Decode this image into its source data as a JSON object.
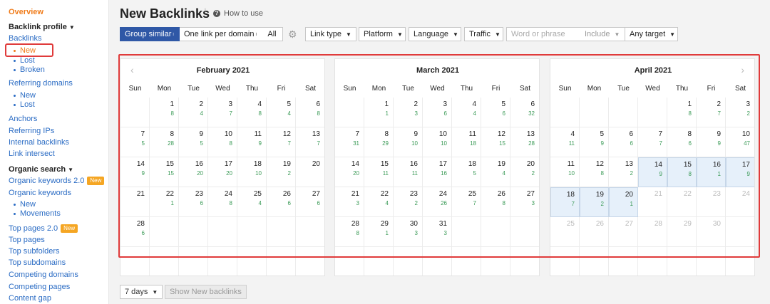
{
  "sidebar": {
    "overview": "Overview",
    "backlink_profile": "Backlink profile",
    "backlinks": "Backlinks",
    "backlinks_new": "New",
    "backlinks_lost": "Lost",
    "backlinks_broken": "Broken",
    "referring_domains": "Referring domains",
    "rd_new": "New",
    "rd_lost": "Lost",
    "anchors": "Anchors",
    "referring_ips": "Referring IPs",
    "internal_backlinks": "Internal backlinks",
    "link_intersect": "Link intersect",
    "organic_search": "Organic search",
    "organic_keywords_2": "Organic keywords 2.0",
    "new_badge": "New",
    "organic_keywords": "Organic keywords",
    "ok_new": "New",
    "ok_movements": "Movements",
    "top_pages_2": "Top pages 2.0",
    "top_pages": "Top pages",
    "top_subfolders": "Top subfolders",
    "top_subdomains": "Top subdomains",
    "competing_domains": "Competing domains",
    "competing_pages": "Competing pages",
    "content_gap": "Content gap"
  },
  "header": {
    "title": "New Backlinks",
    "title_info": "i",
    "how_to": "How to use"
  },
  "toolbar": {
    "group_similar": "Group similar",
    "one_link": "One link per domain",
    "all": "All",
    "link_type": "Link type",
    "platform": "Platform",
    "language": "Language",
    "traffic": "Traffic",
    "search_placeholder": "Word or phrase",
    "include": "Include",
    "any_target": "Any target"
  },
  "weekdays": [
    "Sun",
    "Mon",
    "Tue",
    "Wed",
    "Thu",
    "Fri",
    "Sat"
  ],
  "months": [
    {
      "name": "February 2021",
      "weeks": [
        [
          {
            "d": ""
          },
          {
            "d": "1",
            "c": "8"
          },
          {
            "d": "2",
            "c": "4"
          },
          {
            "d": "3",
            "c": "7"
          },
          {
            "d": "4",
            "c": "8"
          },
          {
            "d": "5",
            "c": "4"
          },
          {
            "d": "6",
            "c": "8"
          }
        ],
        [
          {
            "d": "7",
            "c": "5"
          },
          {
            "d": "8",
            "c": "28"
          },
          {
            "d": "9",
            "c": "5"
          },
          {
            "d": "10",
            "c": "8"
          },
          {
            "d": "11",
            "c": "9"
          },
          {
            "d": "12",
            "c": "7"
          },
          {
            "d": "13",
            "c": "7"
          }
        ],
        [
          {
            "d": "14",
            "c": "9"
          },
          {
            "d": "15",
            "c": "15"
          },
          {
            "d": "16",
            "c": "20"
          },
          {
            "d": "17",
            "c": "20"
          },
          {
            "d": "18",
            "c": "10"
          },
          {
            "d": "19",
            "c": "2"
          },
          {
            "d": "20"
          }
        ],
        [
          {
            "d": "21"
          },
          {
            "d": "22",
            "c": "1"
          },
          {
            "d": "23",
            "c": "6"
          },
          {
            "d": "24",
            "c": "8"
          },
          {
            "d": "25",
            "c": "4"
          },
          {
            "d": "26",
            "c": "6"
          },
          {
            "d": "27",
            "c": "6"
          }
        ],
        [
          {
            "d": "28",
            "c": "6"
          },
          {
            "d": ""
          },
          {
            "d": ""
          },
          {
            "d": ""
          },
          {
            "d": ""
          },
          {
            "d": ""
          },
          {
            "d": ""
          }
        ],
        [
          {
            "d": ""
          },
          {
            "d": ""
          },
          {
            "d": ""
          },
          {
            "d": ""
          },
          {
            "d": ""
          },
          {
            "d": ""
          },
          {
            "d": ""
          }
        ]
      ]
    },
    {
      "name": "March 2021",
      "weeks": [
        [
          {
            "d": ""
          },
          {
            "d": "1",
            "c": "1"
          },
          {
            "d": "2",
            "c": "3"
          },
          {
            "d": "3",
            "c": "6"
          },
          {
            "d": "4",
            "c": "4"
          },
          {
            "d": "5",
            "c": "6"
          },
          {
            "d": "6",
            "c": "32"
          }
        ],
        [
          {
            "d": "7",
            "c": "31"
          },
          {
            "d": "8",
            "c": "29"
          },
          {
            "d": "9",
            "c": "10"
          },
          {
            "d": "10",
            "c": "10"
          },
          {
            "d": "11",
            "c": "18"
          },
          {
            "d": "12",
            "c": "15"
          },
          {
            "d": "13",
            "c": "28"
          }
        ],
        [
          {
            "d": "14",
            "c": "20"
          },
          {
            "d": "15",
            "c": "11"
          },
          {
            "d": "16",
            "c": "11"
          },
          {
            "d": "17",
            "c": "16"
          },
          {
            "d": "18",
            "c": "5"
          },
          {
            "d": "19",
            "c": "4"
          },
          {
            "d": "20",
            "c": "2"
          }
        ],
        [
          {
            "d": "21",
            "c": "3"
          },
          {
            "d": "22",
            "c": "4"
          },
          {
            "d": "23",
            "c": "2"
          },
          {
            "d": "24",
            "c": "26"
          },
          {
            "d": "25",
            "c": "7"
          },
          {
            "d": "26",
            "c": "8"
          },
          {
            "d": "27",
            "c": "3"
          }
        ],
        [
          {
            "d": "28",
            "c": "8"
          },
          {
            "d": "29",
            "c": "1"
          },
          {
            "d": "30",
            "c": "3"
          },
          {
            "d": "31",
            "c": "3"
          },
          {
            "d": ""
          },
          {
            "d": ""
          },
          {
            "d": ""
          }
        ],
        [
          {
            "d": ""
          },
          {
            "d": ""
          },
          {
            "d": ""
          },
          {
            "d": ""
          },
          {
            "d": ""
          },
          {
            "d": ""
          },
          {
            "d": ""
          }
        ]
      ]
    },
    {
      "name": "April 2021",
      "weeks": [
        [
          {
            "d": ""
          },
          {
            "d": ""
          },
          {
            "d": ""
          },
          {
            "d": ""
          },
          {
            "d": "1",
            "c": "8"
          },
          {
            "d": "2",
            "c": "7"
          },
          {
            "d": "3",
            "c": "2"
          }
        ],
        [
          {
            "d": "4",
            "c": "11"
          },
          {
            "d": "5",
            "c": "9"
          },
          {
            "d": "6",
            "c": "6"
          },
          {
            "d": "7",
            "c": "7"
          },
          {
            "d": "8",
            "c": "6"
          },
          {
            "d": "9",
            "c": "9"
          },
          {
            "d": "10",
            "c": "47"
          }
        ],
        [
          {
            "d": "11",
            "c": "10"
          },
          {
            "d": "12",
            "c": "8"
          },
          {
            "d": "13",
            "c": "2"
          },
          {
            "d": "14",
            "c": "9",
            "hl": true
          },
          {
            "d": "15",
            "c": "8",
            "hl": true
          },
          {
            "d": "16",
            "c": "1",
            "hl": true
          },
          {
            "d": "17",
            "c": "9",
            "hl": true
          }
        ],
        [
          {
            "d": "18",
            "c": "7",
            "hl": true
          },
          {
            "d": "19",
            "c": "2",
            "hl": true
          },
          {
            "d": "20",
            "c": "1",
            "hl": true
          },
          {
            "d": "21",
            "dim": true
          },
          {
            "d": "22",
            "dim": true
          },
          {
            "d": "23",
            "dim": true
          },
          {
            "d": "24",
            "dim": true
          }
        ],
        [
          {
            "d": "25",
            "dim": true
          },
          {
            "d": "26",
            "dim": true
          },
          {
            "d": "27",
            "dim": true
          },
          {
            "d": "28",
            "dim": true
          },
          {
            "d": "29",
            "dim": true
          },
          {
            "d": "30",
            "dim": true
          },
          {
            "d": ""
          }
        ],
        [
          {
            "d": ""
          },
          {
            "d": ""
          },
          {
            "d": ""
          },
          {
            "d": ""
          },
          {
            "d": ""
          },
          {
            "d": ""
          },
          {
            "d": ""
          }
        ]
      ]
    }
  ],
  "bottom": {
    "days": "7 days",
    "show_button": "Show New backlinks"
  },
  "colors": {
    "accent": "#2f58a6",
    "orange": "#f07c1b",
    "count_green": "#3a9a56",
    "highlight": "#e03b3b"
  },
  "icons": {
    "gear": "gear-icon",
    "help": "question-icon",
    "prev": "chevron-left-icon",
    "next": "chevron-right-icon"
  }
}
